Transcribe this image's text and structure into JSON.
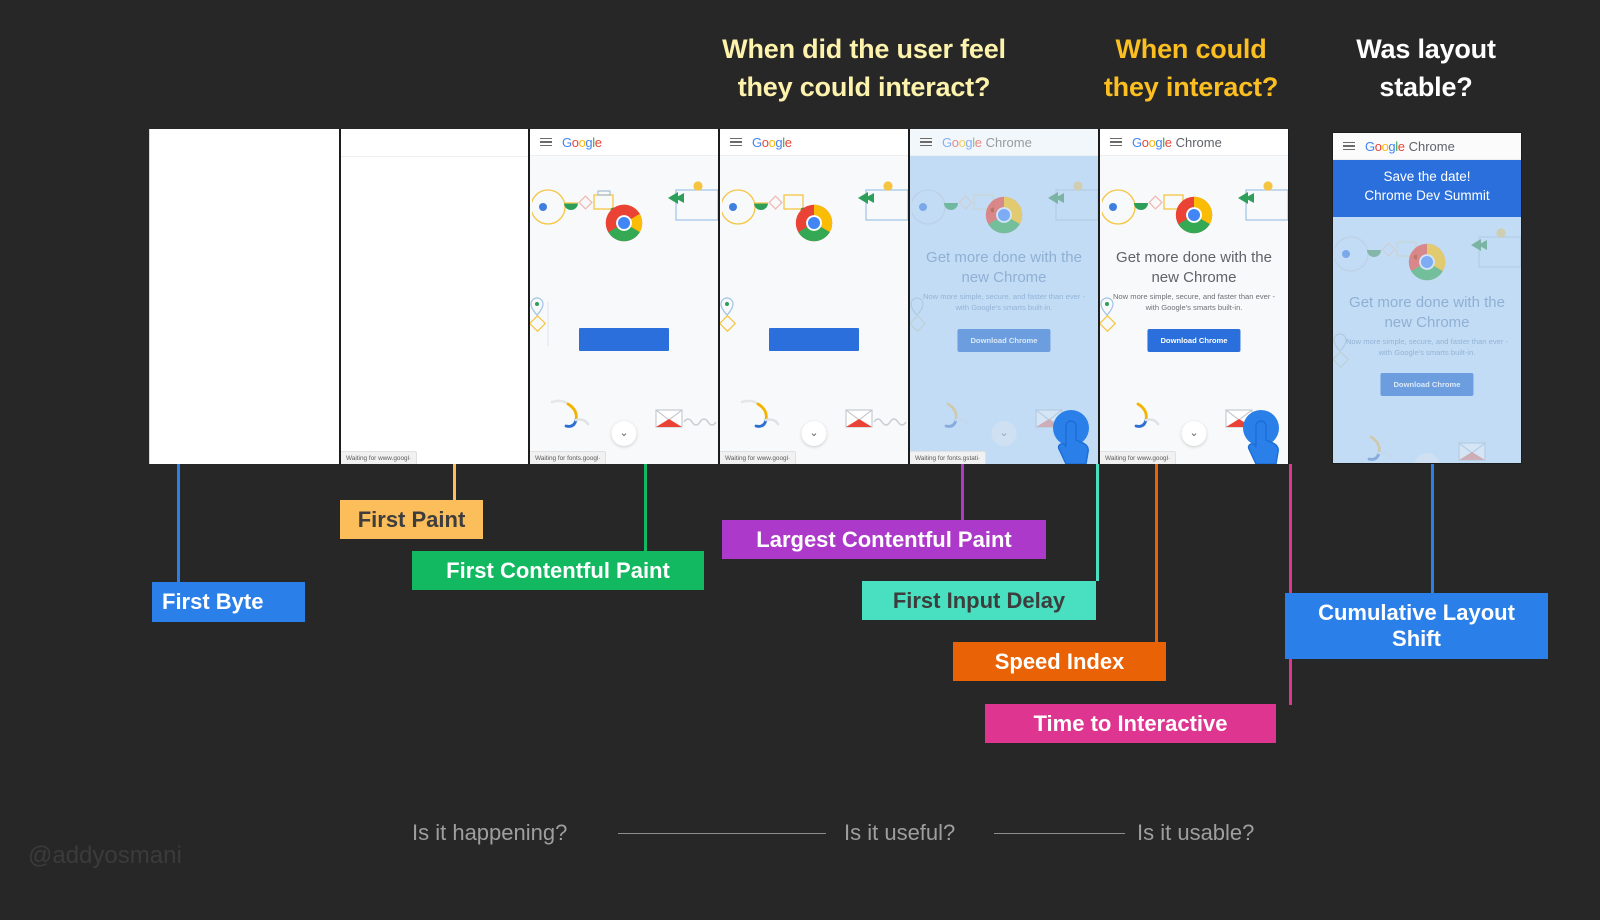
{
  "headers": [
    {
      "id": "felt",
      "text": "When did the user feel\nthey could interact?",
      "color": "#fdf3ac"
    },
    {
      "id": "could",
      "text": "When could\nthey interact?",
      "color": "#fcbf21"
    },
    {
      "id": "stable",
      "text": "Was layout\nstable?",
      "color": "#ffffff"
    }
  ],
  "brand": {
    "google": "Google",
    "chrome_suffix": "Chrome",
    "hero_headline": "Get more done with the\nnew Chrome",
    "hero_subline": "Now more simple, secure, and faster than ever -\nwith Google's smarts built-in.",
    "cta_label": "Download Chrome",
    "cls_banner": "Save the date!\nChrome Dev Summit",
    "chevron_glyph": "⌄"
  },
  "frames": [
    {
      "id": "frame-1",
      "state": "blank-white",
      "status": "",
      "has_bar": false,
      "tinted": false
    },
    {
      "id": "frame-2",
      "state": "first-paint",
      "status": "Waiting for www.googl·",
      "has_bar": false,
      "tinted": false
    },
    {
      "id": "frame-3",
      "state": "first-contentful",
      "status": "Waiting for fonts.googl·",
      "has_bar": true,
      "tinted": false
    },
    {
      "id": "frame-4",
      "state": "contentful-2",
      "status": "Waiting for www.googl·",
      "has_bar": true,
      "tinted": false
    },
    {
      "id": "frame-5",
      "state": "lcp-tinted",
      "status": "Waiting for fonts.gstati·",
      "has_bar": true,
      "tinted": true
    },
    {
      "id": "frame-6",
      "state": "interactive",
      "status": "Waiting for www.googl·",
      "has_bar": true,
      "tinted": false
    },
    {
      "id": "frame-7",
      "state": "layout-shift",
      "status": "",
      "has_bar": true,
      "tinted": true
    }
  ],
  "metrics": [
    {
      "id": "ttfb",
      "label": "First Byte",
      "bg": "#2a7fe8",
      "fg": "#ffffff"
    },
    {
      "id": "fp",
      "label": "First Paint",
      "bg": "#fbbe5b",
      "fg": "#3d3d3d"
    },
    {
      "id": "fcp",
      "label": "First Contentful Paint",
      "bg": "#12b961",
      "fg": "#ffffff"
    },
    {
      "id": "lcp",
      "label": "Largest Contentful Paint",
      "bg": "#ac39c9",
      "fg": "#ffffff"
    },
    {
      "id": "fid",
      "label": "First Input Delay",
      "bg": "#48e0c0",
      "fg": "#3d3d3d"
    },
    {
      "id": "si",
      "label": "Speed Index",
      "bg": "#e96206",
      "fg": "#ffffff"
    },
    {
      "id": "tti",
      "label": "Time to Interactive",
      "bg": "#dd3590",
      "fg": "#ffffff"
    },
    {
      "id": "cls",
      "label": "Cumulative Layout\nShift",
      "bg": "#2a7fe8",
      "fg": "#ffffff"
    }
  ],
  "rail": {
    "happening": "Is it happening?",
    "useful": "Is it useful?",
    "usable": "Is it usable?"
  },
  "watermark": "@addyosmani",
  "background": "#272727"
}
